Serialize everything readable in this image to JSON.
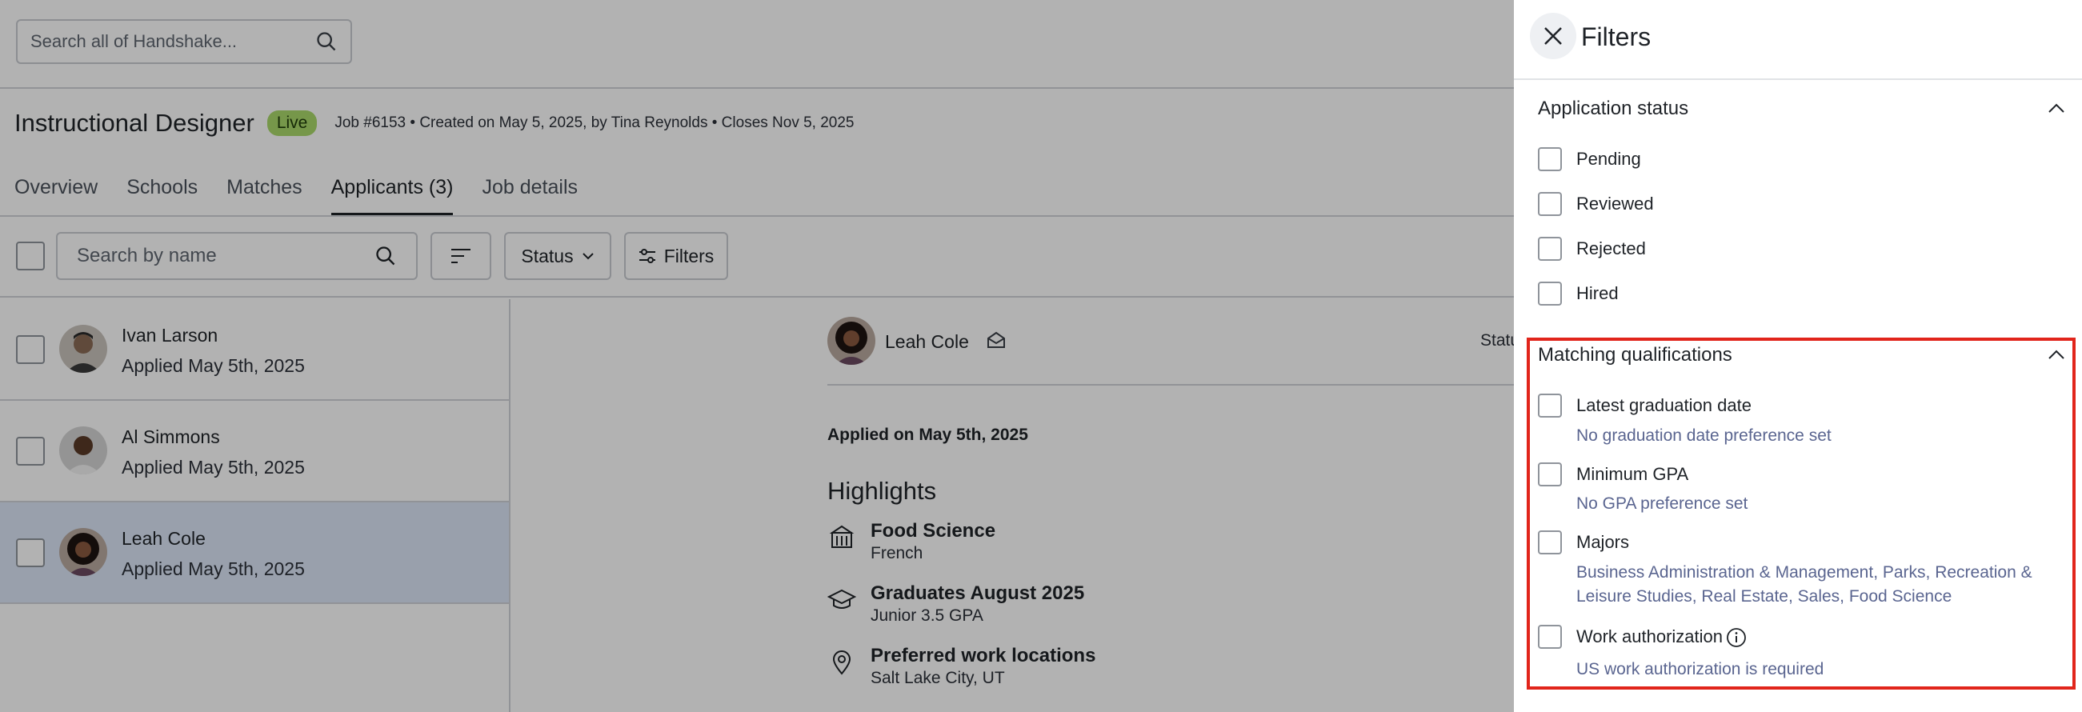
{
  "global_search": {
    "placeholder": "Search all of Handshake..."
  },
  "job": {
    "title": "Instructional Designer",
    "status_badge": "Live",
    "meta": "Job #6153 • Created on May 5, 2025, by Tina Reynolds • Closes Nov 5, 2025"
  },
  "tabs": [
    {
      "label": "Overview"
    },
    {
      "label": "Schools"
    },
    {
      "label": "Matches"
    },
    {
      "label": "Applicants (3)"
    },
    {
      "label": "Job details"
    }
  ],
  "toolbar": {
    "search_placeholder": "Search by name",
    "status_label": "Status",
    "filters_label": "Filters"
  },
  "applicants": [
    {
      "name": "Ivan Larson",
      "applied": "Applied May 5th, 2025"
    },
    {
      "name": "Al Simmons",
      "applied": "Applied May 5th, 2025"
    },
    {
      "name": "Leah Cole",
      "applied": "Applied May 5th, 2025"
    }
  ],
  "detail": {
    "name": "Leah Cole",
    "status_partial": "Statu",
    "applied": "Applied on May 5th, 2025",
    "highlights_title": "Highlights",
    "highlights": [
      {
        "icon": "school-building-icon",
        "main": "Food Science",
        "sub": "French"
      },
      {
        "icon": "graduation-cap-icon",
        "main": "Graduates August 2025",
        "sub": "Junior 3.5 GPA"
      },
      {
        "icon": "location-pin-icon",
        "main": "Preferred work locations",
        "sub": "Salt Lake City, UT"
      }
    ]
  },
  "filters_panel": {
    "title": "Filters",
    "application_status": {
      "title": "Application status",
      "options": [
        "Pending",
        "Reviewed",
        "Rejected",
        "Hired"
      ]
    },
    "matching_qualifications": {
      "title": "Matching qualifications",
      "options": [
        {
          "label": "Latest graduation date",
          "sub": "No graduation date preference set"
        },
        {
          "label": "Minimum GPA",
          "sub": "No GPA preference set"
        },
        {
          "label": "Majors",
          "sub": "Business Administration & Management, Parks, Recreation & Leisure Studies, Real Estate, Sales, Food Science"
        },
        {
          "label": "Work authorization",
          "sub": "US work authorization is required"
        }
      ]
    }
  },
  "colors": {
    "live_badge": "#a9d86a",
    "selected_row": "#dbe6f7",
    "highlight_border": "#e1251b",
    "sub_text": "#5a6590"
  }
}
